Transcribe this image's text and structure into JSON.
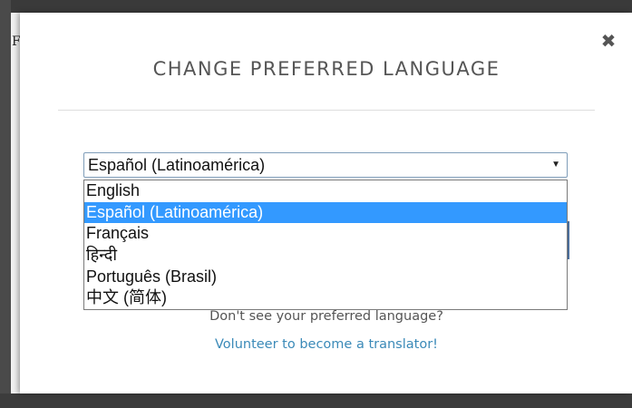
{
  "background": {
    "glyph": "F"
  },
  "modal": {
    "title": "CHANGE PREFERRED LANGUAGE",
    "close_icon": "close-icon",
    "select": {
      "value": "Español (Latinoamérica)",
      "arrow": "▼",
      "options": [
        "English",
        "Español (Latinoamérica)",
        "Français",
        "हिन्दी",
        "Português (Brasil)",
        "中文 (简体)"
      ],
      "selected_index": 1
    },
    "prompt": "Don't see your preferred language?",
    "volunteer_link": "Volunteer to become a translator!"
  },
  "colors": {
    "accent_link": "#3b8ab8",
    "selected_option": "#3399ff"
  }
}
